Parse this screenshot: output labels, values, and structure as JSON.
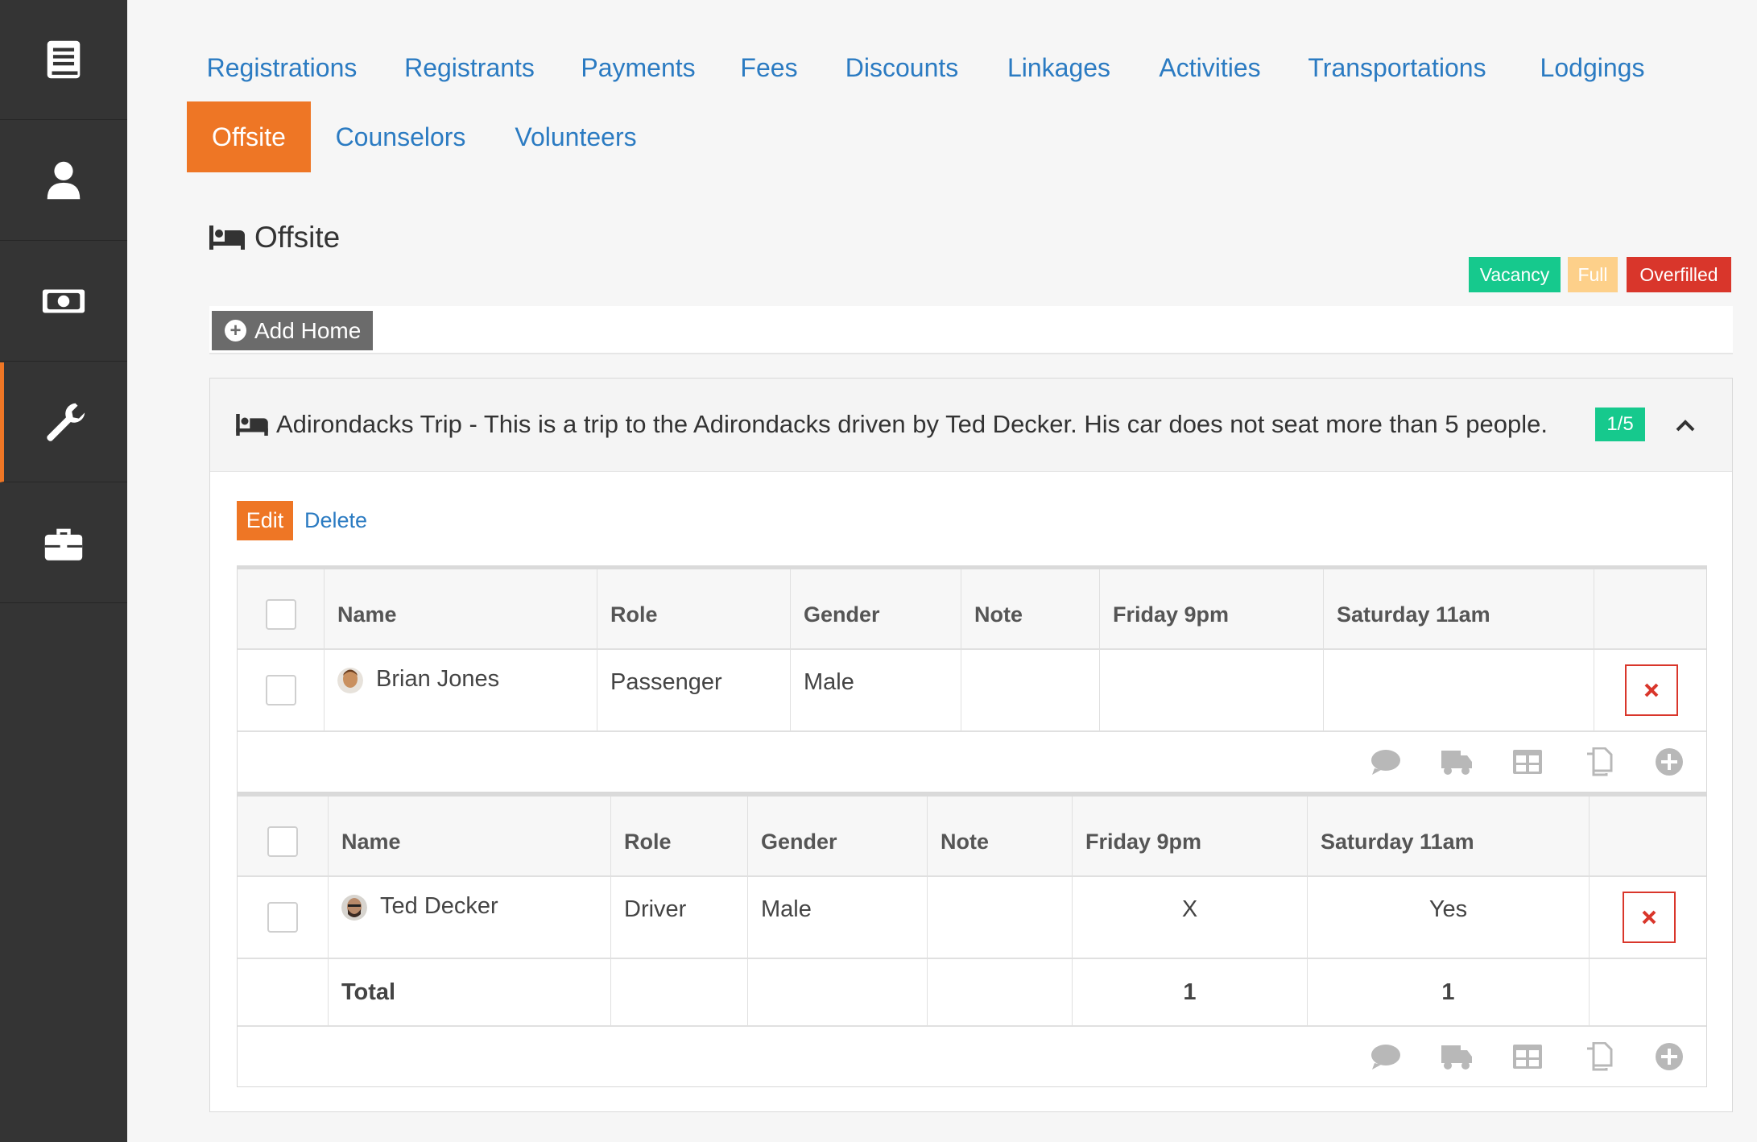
{
  "sidebar": {
    "items": [
      {
        "icon": "book-icon"
      },
      {
        "icon": "user-icon"
      },
      {
        "icon": "money-icon"
      },
      {
        "icon": "wrench-icon"
      },
      {
        "icon": "briefcase-icon"
      }
    ]
  },
  "tabs": [
    {
      "label": "Registrations"
    },
    {
      "label": "Registrants"
    },
    {
      "label": "Payments"
    },
    {
      "label": "Fees"
    },
    {
      "label": "Discounts"
    },
    {
      "label": "Linkages"
    },
    {
      "label": "Activities"
    },
    {
      "label": "Transportations"
    },
    {
      "label": "Lodgings"
    },
    {
      "label": "Offsite",
      "active": true
    },
    {
      "label": "Counselors"
    },
    {
      "label": "Volunteers"
    }
  ],
  "page_title": "Offsite",
  "legend": {
    "vacancy": "Vacancy",
    "full": "Full",
    "overfilled": "Overfilled",
    "colors": {
      "vacancy": "#16c98d",
      "full": "#fdd08a",
      "overfilled": "#d9362b"
    }
  },
  "add_home_label": "Add Home",
  "panel": {
    "title": "Adirondacks Trip - This is a trip to the Adirondacks driven by Ted Decker. His car does not seat more than 5 people.",
    "count": "1/5",
    "edit_label": "Edit",
    "delete_label": "Delete"
  },
  "passengers": {
    "columns": [
      "Name",
      "Role",
      "Gender",
      "Note",
      "Friday 9pm",
      "Saturday 11am"
    ],
    "rows": [
      {
        "name": "Brian Jones",
        "role": "Passenger",
        "gender": "Male",
        "note": "",
        "friday": "",
        "saturday": ""
      }
    ]
  },
  "drivers": {
    "columns": [
      "Name",
      "Role",
      "Gender",
      "Note",
      "Friday 9pm",
      "Saturday 11am"
    ],
    "rows": [
      {
        "name": "Ted Decker",
        "role": "Driver",
        "gender": "Male",
        "note": "",
        "friday": "X",
        "saturday": "Yes"
      }
    ],
    "total": {
      "label": "Total",
      "friday": "1",
      "saturday": "1"
    }
  },
  "action_icons": [
    "comment-icon",
    "truck-icon",
    "table-icon",
    "copy-icon",
    "add-circle-icon"
  ],
  "accent": "#ee7625",
  "link_color": "#2b7bc2"
}
